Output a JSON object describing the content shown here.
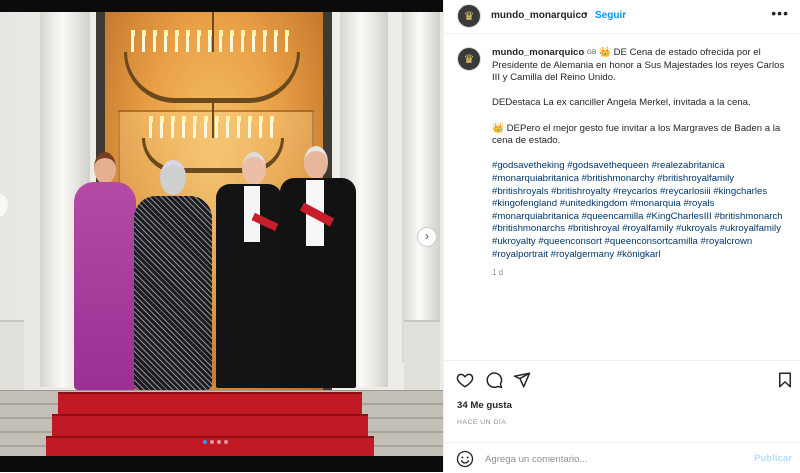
{
  "post": {
    "username": "mundo_monarquico",
    "follow_label": "Seguir",
    "more_label": "•••",
    "caption": {
      "badge": "GB",
      "line1": "👑 DE Cena de estado ofrecida por el Presidente de Alemania en honor a Sus Majestades los reyes Carlos III y Camilla del Reino Unido.",
      "line2": "DEDestaca La ex canciller Angela Merkel, invitada a la cena.",
      "line3": "👑 DEPero el mejor gesto fue invitar a los Margraves de Baden a la cena de estado.",
      "hashtags": "#godsavetheking #godsavethequeen #realezabritanica #monarquiabritanica #britishmonarchy #britishroyalfamily #britishroyals #britishroyalty #reycarlos #reycarlosiii #kingcharles #kingofengland #unitedkingdom #monarquia #royals #monarquiabritanica #queencamilla #KingCharlesIII #britishmonarch #britishmonarchs #britishroyal #royalfamily #ukroyals #ukroyalfamily #ukroyalty #queenconsort #queenconsortcamilla #royalcrown #royalportrait #royalgermany #königkarl",
      "time_ago": "1 d"
    },
    "likes": "34 Me gusta",
    "posted": "HACE UN DÍA",
    "comment_placeholder": "Agrega un comentario...",
    "publish_label": "Publicar"
  },
  "carousel": {
    "next_label": "›",
    "dot_count": 4,
    "active_dot": 0
  },
  "icons": {
    "avatar": "crown-icon",
    "like": "heart-icon",
    "comment": "comment-bubble-icon",
    "share": "paper-plane-icon",
    "save": "bookmark-icon",
    "emoji": "smiley-icon"
  },
  "colors": {
    "link": "#0095f6",
    "hashtag": "#00376b",
    "publish_disabled": "#b2dffc",
    "carousel_active": "#2f9bf5",
    "carpet": "#c11a24"
  }
}
